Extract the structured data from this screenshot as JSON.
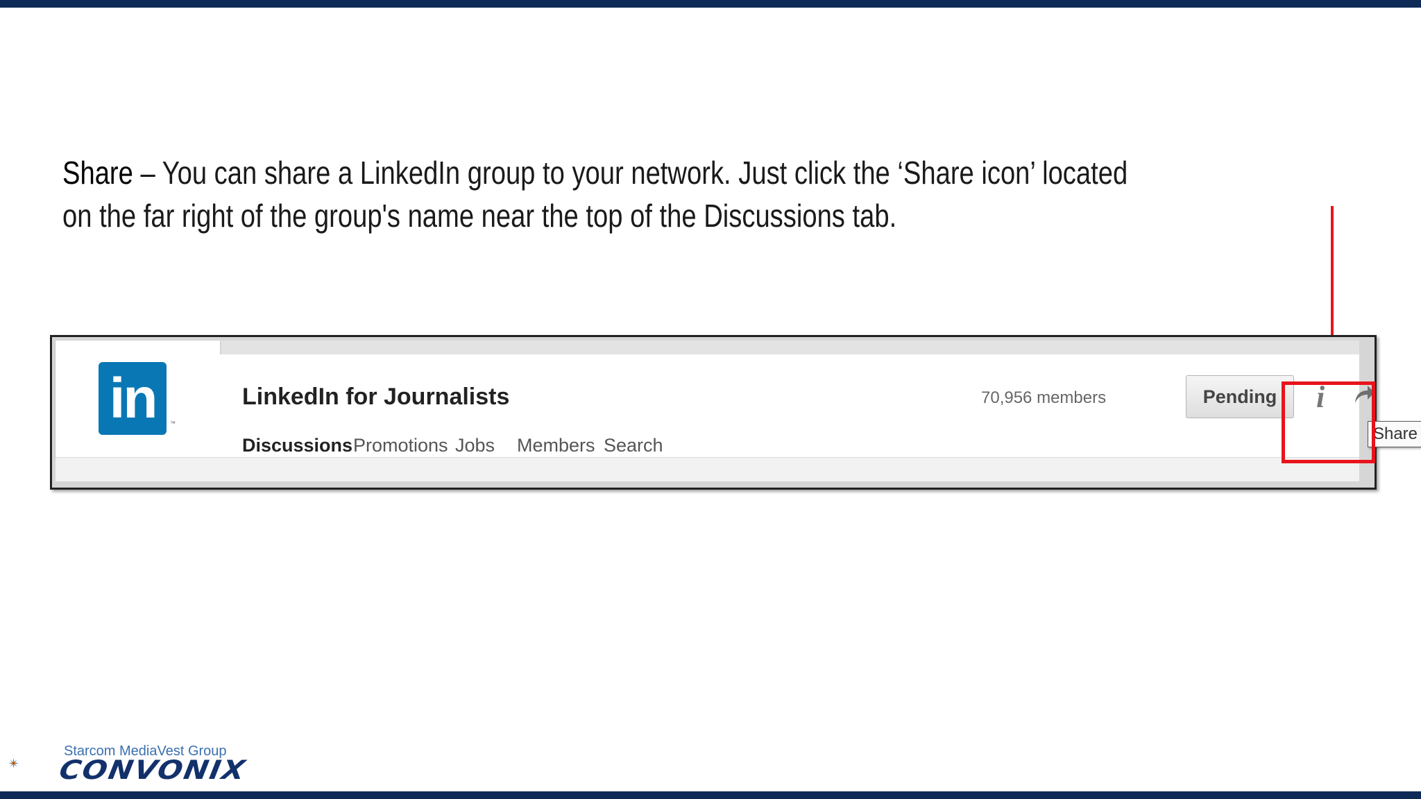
{
  "intro": {
    "keyword": "Share",
    "text": " – You can share a LinkedIn group to your network. Just click the ‘Share icon’ located on the far right of the group's name near the top of the Discussions tab."
  },
  "group": {
    "logo_text": "in",
    "logo_tm": "™",
    "name": "LinkedIn for Journalists",
    "members": "70,956 members",
    "pending_label": "Pending",
    "info_label": "i",
    "share_tooltip": "Share"
  },
  "tabs": [
    "Discussions",
    "Promotions",
    "Jobs",
    "Members",
    "Search"
  ],
  "branding": {
    "subtitle": "Starcom MediaVest Group",
    "name": "CONVONIX"
  },
  "colors": {
    "linkedin_blue": "#0a77b5",
    "highlight_red": "#e8131b",
    "frame_navy": "#0e2a56"
  }
}
